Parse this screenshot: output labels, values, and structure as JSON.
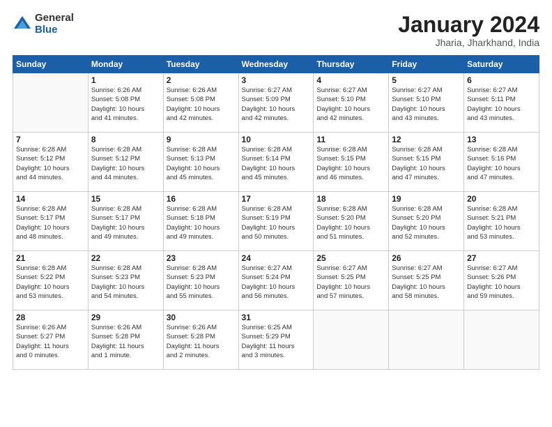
{
  "logo": {
    "general": "General",
    "blue": "Blue"
  },
  "header": {
    "month": "January 2024",
    "location": "Jharia, Jharkhand, India"
  },
  "days_of_week": [
    "Sunday",
    "Monday",
    "Tuesday",
    "Wednesday",
    "Thursday",
    "Friday",
    "Saturday"
  ],
  "weeks": [
    [
      {
        "day": "",
        "info": ""
      },
      {
        "day": "1",
        "info": "Sunrise: 6:26 AM\nSunset: 5:08 PM\nDaylight: 10 hours\nand 41 minutes."
      },
      {
        "day": "2",
        "info": "Sunrise: 6:26 AM\nSunset: 5:08 PM\nDaylight: 10 hours\nand 42 minutes."
      },
      {
        "day": "3",
        "info": "Sunrise: 6:27 AM\nSunset: 5:09 PM\nDaylight: 10 hours\nand 42 minutes."
      },
      {
        "day": "4",
        "info": "Sunrise: 6:27 AM\nSunset: 5:10 PM\nDaylight: 10 hours\nand 42 minutes."
      },
      {
        "day": "5",
        "info": "Sunrise: 6:27 AM\nSunset: 5:10 PM\nDaylight: 10 hours\nand 43 minutes."
      },
      {
        "day": "6",
        "info": "Sunrise: 6:27 AM\nSunset: 5:11 PM\nDaylight: 10 hours\nand 43 minutes."
      }
    ],
    [
      {
        "day": "7",
        "info": "Sunrise: 6:28 AM\nSunset: 5:12 PM\nDaylight: 10 hours\nand 44 minutes."
      },
      {
        "day": "8",
        "info": "Sunrise: 6:28 AM\nSunset: 5:12 PM\nDaylight: 10 hours\nand 44 minutes."
      },
      {
        "day": "9",
        "info": "Sunrise: 6:28 AM\nSunset: 5:13 PM\nDaylight: 10 hours\nand 45 minutes."
      },
      {
        "day": "10",
        "info": "Sunrise: 6:28 AM\nSunset: 5:14 PM\nDaylight: 10 hours\nand 45 minutes."
      },
      {
        "day": "11",
        "info": "Sunrise: 6:28 AM\nSunset: 5:15 PM\nDaylight: 10 hours\nand 46 minutes."
      },
      {
        "day": "12",
        "info": "Sunrise: 6:28 AM\nSunset: 5:15 PM\nDaylight: 10 hours\nand 47 minutes."
      },
      {
        "day": "13",
        "info": "Sunrise: 6:28 AM\nSunset: 5:16 PM\nDaylight: 10 hours\nand 47 minutes."
      }
    ],
    [
      {
        "day": "14",
        "info": "Sunrise: 6:28 AM\nSunset: 5:17 PM\nDaylight: 10 hours\nand 48 minutes."
      },
      {
        "day": "15",
        "info": "Sunrise: 6:28 AM\nSunset: 5:17 PM\nDaylight: 10 hours\nand 49 minutes."
      },
      {
        "day": "16",
        "info": "Sunrise: 6:28 AM\nSunset: 5:18 PM\nDaylight: 10 hours\nand 49 minutes."
      },
      {
        "day": "17",
        "info": "Sunrise: 6:28 AM\nSunset: 5:19 PM\nDaylight: 10 hours\nand 50 minutes."
      },
      {
        "day": "18",
        "info": "Sunrise: 6:28 AM\nSunset: 5:20 PM\nDaylight: 10 hours\nand 51 minutes."
      },
      {
        "day": "19",
        "info": "Sunrise: 6:28 AM\nSunset: 5:20 PM\nDaylight: 10 hours\nand 52 minutes."
      },
      {
        "day": "20",
        "info": "Sunrise: 6:28 AM\nSunset: 5:21 PM\nDaylight: 10 hours\nand 53 minutes."
      }
    ],
    [
      {
        "day": "21",
        "info": "Sunrise: 6:28 AM\nSunset: 5:22 PM\nDaylight: 10 hours\nand 53 minutes."
      },
      {
        "day": "22",
        "info": "Sunrise: 6:28 AM\nSunset: 5:23 PM\nDaylight: 10 hours\nand 54 minutes."
      },
      {
        "day": "23",
        "info": "Sunrise: 6:28 AM\nSunset: 5:23 PM\nDaylight: 10 hours\nand 55 minutes."
      },
      {
        "day": "24",
        "info": "Sunrise: 6:27 AM\nSunset: 5:24 PM\nDaylight: 10 hours\nand 56 minutes."
      },
      {
        "day": "25",
        "info": "Sunrise: 6:27 AM\nSunset: 5:25 PM\nDaylight: 10 hours\nand 57 minutes."
      },
      {
        "day": "26",
        "info": "Sunrise: 6:27 AM\nSunset: 5:25 PM\nDaylight: 10 hours\nand 58 minutes."
      },
      {
        "day": "27",
        "info": "Sunrise: 6:27 AM\nSunset: 5:26 PM\nDaylight: 10 hours\nand 59 minutes."
      }
    ],
    [
      {
        "day": "28",
        "info": "Sunrise: 6:26 AM\nSunset: 5:27 PM\nDaylight: 11 hours\nand 0 minutes."
      },
      {
        "day": "29",
        "info": "Sunrise: 6:26 AM\nSunset: 5:28 PM\nDaylight: 11 hours\nand 1 minute."
      },
      {
        "day": "30",
        "info": "Sunrise: 6:26 AM\nSunset: 5:28 PM\nDaylight: 11 hours\nand 2 minutes."
      },
      {
        "day": "31",
        "info": "Sunrise: 6:25 AM\nSunset: 5:29 PM\nDaylight: 11 hours\nand 3 minutes."
      },
      {
        "day": "",
        "info": ""
      },
      {
        "day": "",
        "info": ""
      },
      {
        "day": "",
        "info": ""
      }
    ]
  ]
}
